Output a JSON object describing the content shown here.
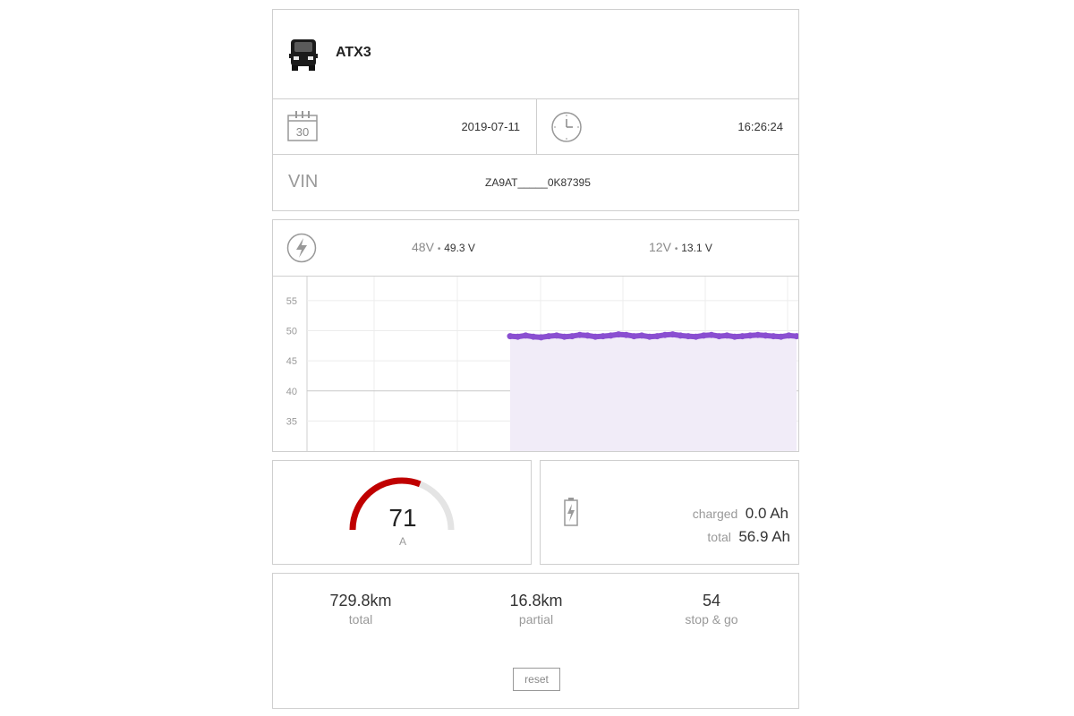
{
  "vehicle": {
    "model": "ATX3",
    "icon": "vehicle-icon"
  },
  "datetime": {
    "calendar_day": "30",
    "date": "2019-07-11",
    "time": "16:26:24"
  },
  "vin": {
    "label": "VIN",
    "value": "ZA9AT_____0K87395"
  },
  "voltage": {
    "v48_label": "48V",
    "v48_value": "49.3 V",
    "v12_label": "12V",
    "v12_value": "13.1 V",
    "bullet": "•"
  },
  "chart_data": {
    "type": "area",
    "y_ticks": [
      "55",
      "50",
      "45",
      "40",
      "35"
    ],
    "ylim": [
      30,
      59
    ],
    "series": [
      {
        "color": "#8a4fd1",
        "fill": "#f1ecf8",
        "values": [
          49.1,
          49.0,
          49.2,
          49.0,
          48.9,
          49.1,
          49.2,
          49.0,
          49.1,
          49.3,
          49.2,
          49.0,
          49.1,
          49.2,
          49.4,
          49.3,
          49.1,
          49.2,
          49.0,
          49.1,
          49.3,
          49.4,
          49.2,
          49.1,
          49.0,
          49.2,
          49.3,
          49.1,
          49.2,
          49.0,
          49.1,
          49.2,
          49.3,
          49.2,
          49.1,
          49.0,
          49.2,
          49.1
        ]
      }
    ],
    "grid": true
  },
  "current_gauge": {
    "value": "71",
    "unit": "A",
    "fraction": 0.62,
    "color": "#c00000"
  },
  "charge": {
    "charged_label": "charged",
    "charged_value": "0.0 Ah",
    "total_label": "total",
    "total_value": "56.9 Ah"
  },
  "odometer": {
    "total_value": "729.8km",
    "total_label": "total",
    "partial_value": "16.8km",
    "partial_label": "partial",
    "stopgo_value": "54",
    "stopgo_label": "stop & go",
    "reset_label": "reset"
  }
}
